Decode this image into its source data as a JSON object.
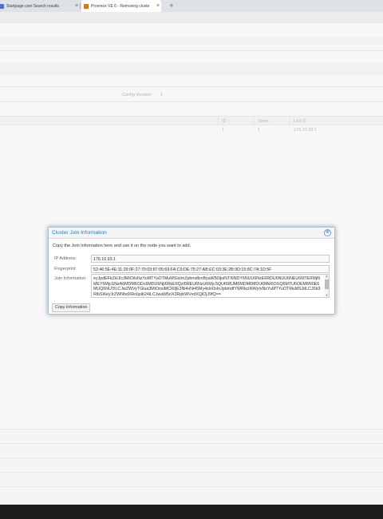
{
  "browser": {
    "tabs": [
      {
        "title": "Startpage.com Search results",
        "favicon": "startpage-icon"
      },
      {
        "title": "Proxmox VE 6 - Removing cluste",
        "favicon": "proxmox-icon"
      }
    ],
    "close_glyph": "×",
    "new_tab_glyph": "+"
  },
  "background": {
    "config_version_label": "Config Version:",
    "config_version_value": "1",
    "grid": {
      "columns": [
        "ID ↑",
        "Votes",
        "Link 0"
      ],
      "rows": [
        [
          "1",
          "1",
          "176.16.93.1"
        ]
      ]
    }
  },
  "dialog": {
    "title": "Cluster Join Information",
    "close_glyph": "⊗",
    "instruction": "Copy the Join Information here and use it on the node you want to add.",
    "ip_label": "IP Address:",
    "ip_value": "176.16.93.1",
    "fingerprint_label": "Fingerprint:",
    "fingerprint_value": "52:46:5E:4E:11:29:0F:27:70:03:87:05:69:FA:C9:DE:75:27:AB:EC:03:3E:2B:9D:15:8C:7A:1D:5F",
    "join_label": "Join Information:",
    "join_value": "eyJpdEFkZHJlc3MiOiIxNzYuMTYuOTMuMSIsImZpbmdlcnByaW50IjoiNTI6NDY6NUU6NzE6RDU6NUU6NEU6MTE6MjI6MEY6MjcSNzA6MDM6ODc6MDU6NjI6RkE6QzI6REU6NzU6MjcSQUI6RUM6MDM6MDU6MkI6OUQ6MTU6OEM6N0E6MUQ6NUYiLCJwZWVyTGlua3MiOnsiMCI6IjE3Ni4xNi45My4xIn0sInJpbmdfYWRkciI6WyIxNzYuMTYuOTMuMSJdLCJ0b3RlbSI6eyJrZWNhdXRoIjoib24iLCJwaW5nX3RpbWVvdXQiOjJ9fQ==",
    "copy_button": "Copy Information"
  },
  "colors": {
    "accent": "#157fcc",
    "dialog_border": "#a3c2e6",
    "taskbar": "#1c1c1c"
  }
}
